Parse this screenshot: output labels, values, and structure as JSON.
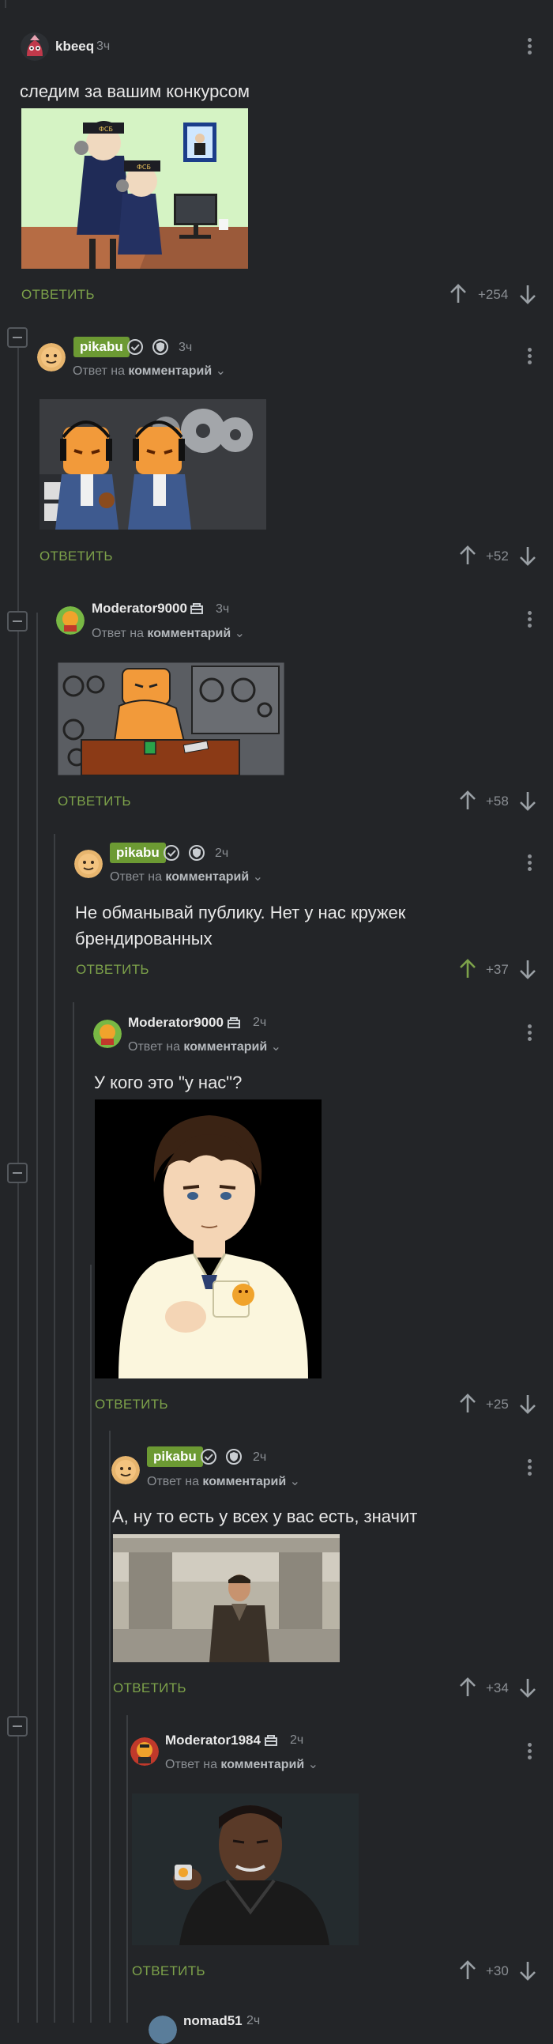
{
  "labels": {
    "reply": "ОТВЕТИТЬ",
    "reply_to": "Ответ на",
    "comment_word": "комментарий"
  },
  "comments": [
    {
      "user": "kbeeq",
      "time": "3ч",
      "text": "следим за вашим конкурсом",
      "rating": "+254"
    },
    {
      "user": "pikabu",
      "time": "3ч",
      "rating": "+52"
    },
    {
      "user": "Moderator9000",
      "time": "3ч",
      "rating": "+58"
    },
    {
      "user": "pikabu",
      "time": "2ч",
      "text": "Не обманывай публику. Нет у нас кружек брендированных",
      "rating": "+37"
    },
    {
      "user": "Moderator9000",
      "time": "2ч",
      "text": "У кого это \"у нас\"?",
      "rating": "+25"
    },
    {
      "user": "pikabu",
      "time": "2ч",
      "text": "А, ну то есть у всех у вас есть, значит",
      "rating": "+34"
    },
    {
      "user": "Moderator1984",
      "time": "2ч",
      "rating": "+30"
    },
    {
      "user": "nomad51",
      "time": "2ч"
    }
  ],
  "images": {
    "img1_text": "ФСБ",
    "img1_text2": "ФСБ"
  },
  "colors": {
    "background": "#232528",
    "accent_green": "#7da24a",
    "pikabu_badge": "#6c9a33"
  }
}
